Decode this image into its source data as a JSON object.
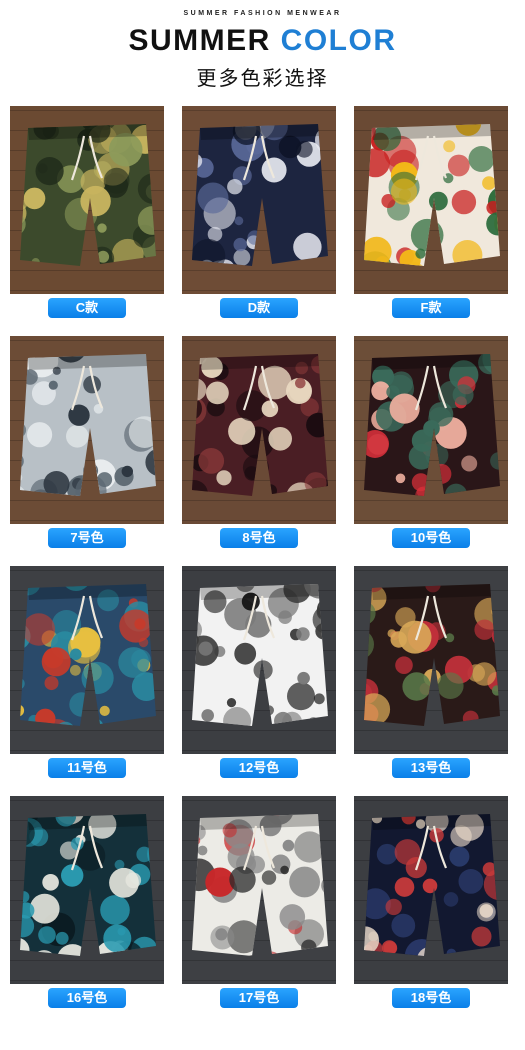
{
  "header": {
    "eyebrow": "SUMMER FASHION MENWEAR",
    "title_main": "SUMMER",
    "title_accent": "COLOR",
    "subtitle": "更多色彩选择",
    "accent_color": "#1f7fd4"
  },
  "label_color": "#0a7fe8",
  "items": [
    {
      "label": "C款",
      "pattern": "paisley-camo"
    },
    {
      "label": "D款",
      "pattern": "navy-paisley"
    },
    {
      "label": "F款",
      "pattern": "red-floral-cream"
    },
    {
      "label": "7号色",
      "pattern": "grey-ink-wash"
    },
    {
      "label": "8号色",
      "pattern": "maroon-tribal"
    },
    {
      "label": "10号色",
      "pattern": "dark-red-floral"
    },
    {
      "label": "11号色",
      "pattern": "multicolor-block"
    },
    {
      "label": "12号色",
      "pattern": "black-white-abstract"
    },
    {
      "label": "13号色",
      "pattern": "dark-red-leaf"
    },
    {
      "label": "16号色",
      "pattern": "teal-floral"
    },
    {
      "label": "17号色",
      "pattern": "white-red-print"
    },
    {
      "label": "18号色",
      "pattern": "navy-feather"
    }
  ]
}
